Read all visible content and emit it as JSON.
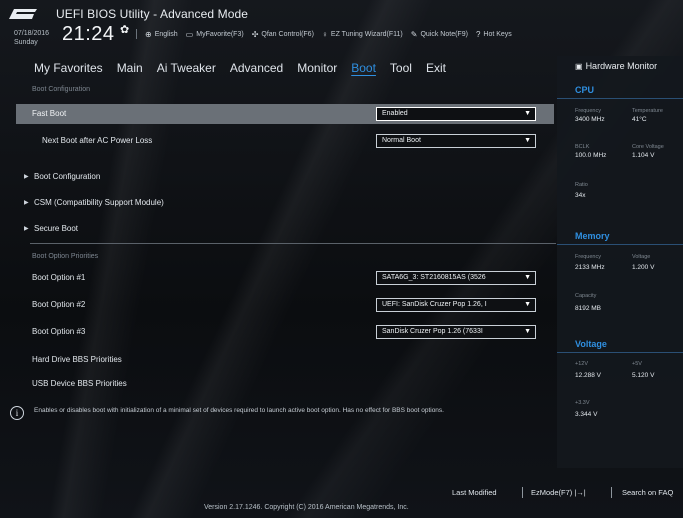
{
  "header": {
    "brand_logo": "ASUS",
    "title": "UEFI BIOS Utility - Advanced Mode",
    "date": "07/18/2016",
    "day": "Sunday",
    "time": "21:24",
    "shortcuts": [
      {
        "icon": "globe-icon",
        "label": "English"
      },
      {
        "icon": "favorite-icon",
        "label": "MyFavorite(F3)"
      },
      {
        "icon": "fan-icon",
        "label": "Qfan Control(F6)"
      },
      {
        "icon": "bulb-icon",
        "label": "EZ Tuning Wizard(F11)"
      },
      {
        "icon": "note-icon",
        "label": "Quick Note(F9)"
      },
      {
        "icon": "help-icon",
        "label": "Hot Keys"
      }
    ]
  },
  "tabs": [
    {
      "label": "My Favorites",
      "active": false
    },
    {
      "label": "Main",
      "active": false
    },
    {
      "label": "Ai Tweaker",
      "active": false
    },
    {
      "label": "Advanced",
      "active": false
    },
    {
      "label": "Monitor",
      "active": false
    },
    {
      "label": "Boot",
      "active": true
    },
    {
      "label": "Tool",
      "active": false
    },
    {
      "label": "Exit",
      "active": false
    }
  ],
  "main": {
    "section_boot_config": "Boot Configuration",
    "fast_boot": {
      "label": "Fast Boot",
      "value": "Enabled"
    },
    "next_boot": {
      "label": "Next Boot after AC Power Loss",
      "value": "Normal Boot"
    },
    "submenus": [
      {
        "label": "Boot Configuration"
      },
      {
        "label": "CSM (Compatibility Support Module)"
      },
      {
        "label": "Secure Boot"
      }
    ],
    "section_priorities": "Boot Option Priorities",
    "boot_options": [
      {
        "label": "Boot Option #1",
        "value": "SATA6G_3: ST2160815AS (3526"
      },
      {
        "label": "Boot Option #2",
        "value": "UEFI: SanDisk Cruzer Pop 1.26, I"
      },
      {
        "label": "Boot Option #3",
        "value": "SanDisk Cruzer Pop 1.26 (7633I"
      }
    ],
    "extra": [
      {
        "label": "Hard Drive BBS Priorities"
      },
      {
        "label": "USB Device BBS Priorities"
      }
    ],
    "help_text": "Enables or disables boot with initialization of a minimal set of devices required to launch active boot option. Has no effect for BBS boot options."
  },
  "hardware_monitor": {
    "title": "Hardware Monitor",
    "cpu": {
      "title": "CPU",
      "frequency_label": "Frequency",
      "frequency": "3400 MHz",
      "temperature_label": "Temperature",
      "temperature": "41°C",
      "bclk_label": "BCLK",
      "bclk": "100.0 MHz",
      "core_voltage_label": "Core Voltage",
      "core_voltage": "1.104 V",
      "ratio_label": "Ratio",
      "ratio": "34x"
    },
    "memory": {
      "title": "Memory",
      "frequency_label": "Frequency",
      "frequency": "2133 MHz",
      "voltage_label": "Voltage",
      "voltage": "1.200 V",
      "capacity_label": "Capacity",
      "capacity": "8192 MB"
    },
    "voltage": {
      "title": "Voltage",
      "v12_label": "+12V",
      "v12": "12.288 V",
      "v5_label": "+5V",
      "v5": "5.120 V",
      "v33_label": "+3.3V",
      "v33": "3.344 V"
    }
  },
  "footer": {
    "last_modified": "Last Modified",
    "ezmode": "EzMode(F7)",
    "search": "Search on FAQ",
    "version": "Version 2.17.1246. Copyright (C) 2016 American Megatrends, Inc."
  },
  "colors": {
    "accent": "#2f8fe0",
    "highlight_row": "#6a7077",
    "background": "#0b0d10"
  }
}
